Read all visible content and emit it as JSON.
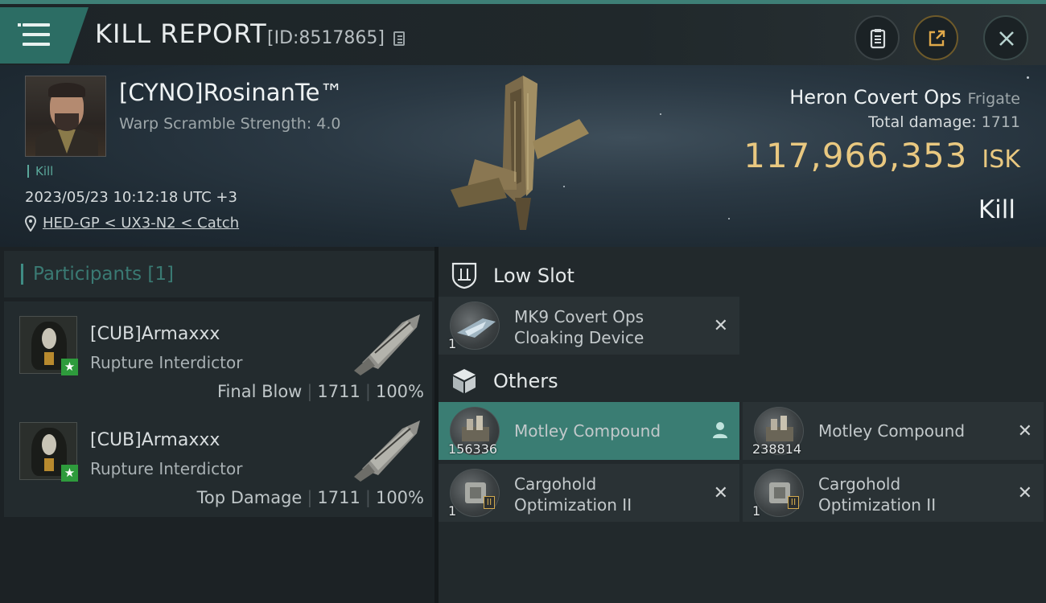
{
  "colors": {
    "accent": "#3e7f76",
    "isk": "#e9c880",
    "selected_row": "#3a7d73"
  },
  "header": {
    "title": "KILL REPORT",
    "report_id": "[ID:8517865]",
    "icons": [
      "menu-icon",
      "copy-icon",
      "clipboard-icon",
      "share-icon",
      "close-icon"
    ]
  },
  "victim": {
    "pilot_name": "[CYNO]RosinanTe™",
    "warp_scramble": "Warp Scramble Strength: 4.0",
    "kill_tag": "Kill",
    "datetime": "2023/05/23 10:12:18 UTC +3",
    "location": "HED-GP < UX3-N2 < Catch",
    "ship_name": "Heron Covert Ops",
    "ship_class": "Frigate",
    "total_damage_label": "Total damage:",
    "total_damage_value": "1711",
    "isk_value": "117,966,353",
    "isk_unit": "ISK",
    "result": "Kill"
  },
  "participants": {
    "title": "Participants [1]",
    "rows": [
      {
        "name": "[CUB]Armaxxx",
        "ship": "Rupture Interdictor",
        "role": "Final Blow",
        "damage": "1711",
        "percent": "100%"
      },
      {
        "name": "[CUB]Armaxxx",
        "ship": "Rupture Interdictor",
        "role": "Top Damage",
        "damage": "1711",
        "percent": "100%"
      }
    ]
  },
  "fitting": {
    "low_slot": {
      "title": "Low Slot",
      "items": [
        {
          "name_line1": "MK9 Covert Ops",
          "name_line2": "Cloaking Device",
          "qty": "1"
        }
      ]
    },
    "others": {
      "title": "Others",
      "items": [
        {
          "name": "Motley Compound",
          "qty": "156336"
        },
        {
          "name": "Motley Compound",
          "qty": "238814"
        },
        {
          "name_line1": "Cargohold",
          "name_line2": "Optimization II",
          "qty": "1"
        },
        {
          "name_line1": "Cargohold",
          "name_line2": "Optimization II",
          "qty": "1"
        }
      ]
    }
  }
}
